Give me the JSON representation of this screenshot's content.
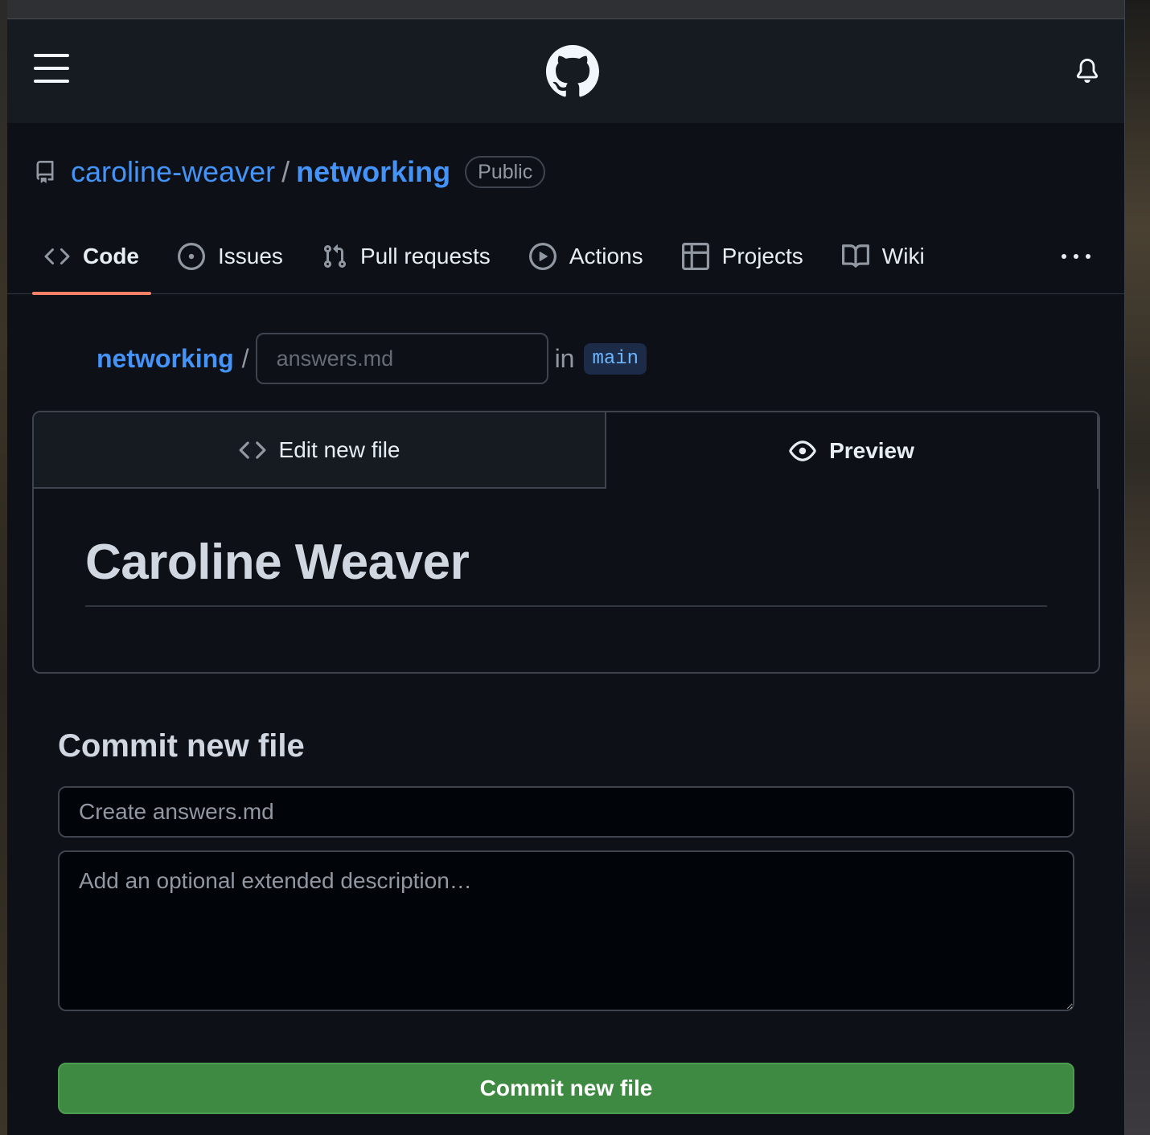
{
  "header": {
    "menu_icon": "hamburger-menu-icon",
    "logo_icon": "github-logo-icon",
    "notifications_icon": "bell-icon"
  },
  "repo": {
    "owner": "caroline-weaver",
    "separator": "/",
    "name": "networking",
    "visibility": "Public"
  },
  "tabs": [
    {
      "label": "Code",
      "icon": "code-icon",
      "selected": true
    },
    {
      "label": "Issues",
      "icon": "issue-opened-icon"
    },
    {
      "label": "Pull requests",
      "icon": "git-pull-request-icon"
    },
    {
      "label": "Actions",
      "icon": "play-icon"
    },
    {
      "label": "Projects",
      "icon": "table-icon"
    },
    {
      "label": "Wiki",
      "icon": "book-icon"
    }
  ],
  "file_path": {
    "repo": "networking",
    "separator": "/",
    "filename_placeholder": "answers.md",
    "in_text": "in",
    "branch": "main"
  },
  "editor": {
    "edit_tab_label": "Edit new file",
    "preview_tab_label": "Preview",
    "preview_heading": "Caroline Weaver"
  },
  "commit": {
    "title": "Commit new file",
    "message_placeholder": "Create answers.md",
    "description_placeholder": "Add an optional extended description…",
    "button_label": "Commit new file"
  },
  "colors": {
    "accent_link": "#4493f8",
    "selected_tab_underline": "#f78166",
    "commit_button": "#3f8a42",
    "background": "#0d1117"
  }
}
